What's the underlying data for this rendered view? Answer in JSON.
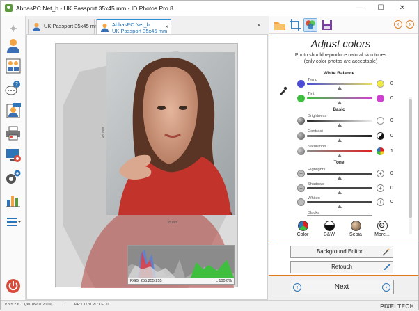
{
  "window": {
    "title": "AbbasPC.Net_b - UK Passport 35x45 mm - ID Photos Pro 8",
    "minimize": "—",
    "maximize": "☐",
    "close": "✕"
  },
  "tabs": [
    {
      "label": "UK Passport 35x45 mm",
      "active": false
    },
    {
      "label_line1": "AbbasPC.Net_b",
      "label_line2": "UK Passport 35x45 mm",
      "active": true,
      "close": "×"
    }
  ],
  "tabs_close_all": "×",
  "canvas": {
    "dim_vertical": "45 mm",
    "dim_horizontal": "35 mm",
    "histogram_status_left": "RGB: 255,255,255",
    "histogram_status_right": "L 100.0%"
  },
  "panel": {
    "title": "Adjust colors",
    "subtitle_line1": "Photo should reproduce natural skin tones",
    "subtitle_line2": "(only color photos are acceptable)",
    "sections": {
      "white_balance": "White Balance",
      "basic": "Basic",
      "tone": "Tone"
    },
    "sliders": {
      "temp": {
        "label": "Temp",
        "value": "0",
        "level": 0.5
      },
      "tint": {
        "label": "Tint",
        "value": "0",
        "level": 0.5
      },
      "brightness": {
        "label": "Brightness",
        "value": "0",
        "level": 0.5
      },
      "contrast": {
        "label": "Contrast",
        "value": "0",
        "level": 0.5
      },
      "saturation": {
        "label": "Saturation",
        "value": "1",
        "level": 0.51
      },
      "highlights": {
        "label": "Highlights",
        "value": "0",
        "level": 0.5
      },
      "shadows": {
        "label": "Shadows",
        "value": "0",
        "level": 0.5
      },
      "whites": {
        "label": "Whites",
        "value": "0",
        "level": 0.5
      },
      "blacks": {
        "label": "Blacks",
        "value": "",
        "level": 0.5
      }
    },
    "presets": {
      "color": "Color",
      "bw": "B&W",
      "sepia": "Sepia",
      "more": "More..."
    },
    "background_editor": "Background Editor...",
    "retouch": "Retouch",
    "next": "Next"
  },
  "status": {
    "version": "v.8.5.2.6",
    "date": "(rel. 05/07/2019)",
    "dots": "..",
    "format": "PF:1 TL:0 PL:1 FL:0",
    "brand": "PIXELTECH"
  },
  "colors": {
    "accent_blue": "#2d8fd5",
    "accent_orange": "#e07a20"
  }
}
